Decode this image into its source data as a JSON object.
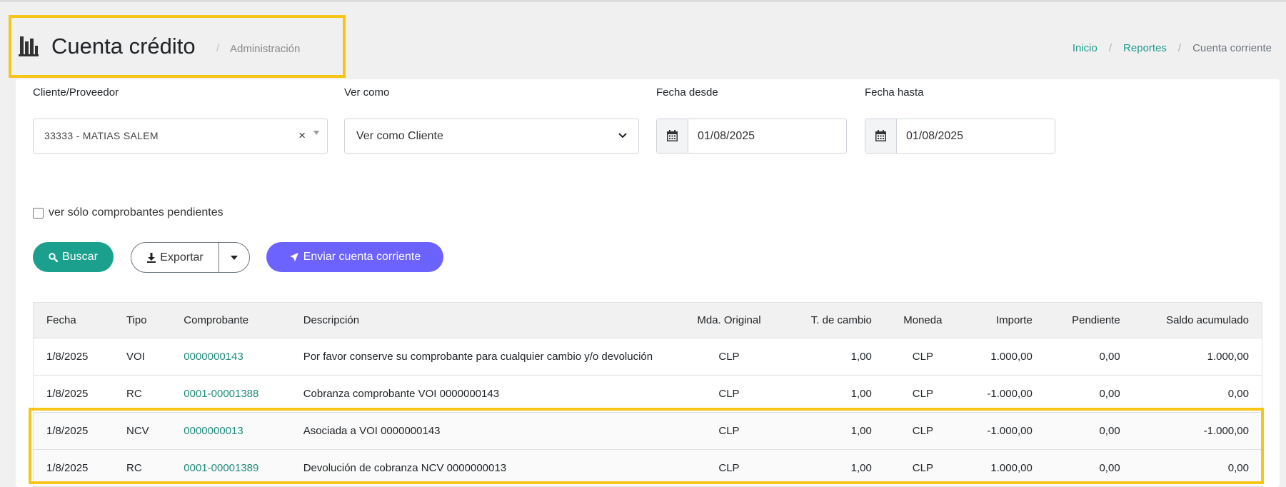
{
  "header": {
    "title": "Cuenta crédito",
    "separator": "/",
    "subtitle": "Administración",
    "breadcrumb": {
      "items": [
        "Inicio",
        "Reportes"
      ],
      "current": "Cuenta corriente"
    }
  },
  "filters": {
    "client_label": "Cliente/Proveedor",
    "client_value": "33333 - MATIAS SALEM",
    "client_clear": "×",
    "vercomo_label": "Ver como",
    "vercomo_value": "Ver como Cliente",
    "fecha_desde_label": "Fecha desde",
    "fecha_desde_value": "01/08/2025",
    "fecha_hasta_label": "Fecha hasta",
    "fecha_hasta_value": "01/08/2025",
    "pendientes_label": "ver sólo comprobantes pendientes",
    "pendientes_checked": false
  },
  "actions": {
    "buscar": "Buscar",
    "exportar": "Exportar",
    "enviar": "Enviar cuenta corriente"
  },
  "icons": {
    "title": "bar-chart-icon",
    "search": "search-icon",
    "download": "download-icon",
    "caret": "caret-down-icon",
    "send": "paper-plane-icon",
    "calendar": "calendar-icon"
  },
  "colors": {
    "accent_teal": "#1aa08d",
    "accent_purple": "#6c63ff",
    "highlight": "#f5c518",
    "link": "#1f8c7c"
  },
  "table": {
    "columns": [
      "Fecha",
      "Tipo",
      "Comprobante",
      "Descripción",
      "Mda. Original",
      "T. de cambio",
      "Moneda",
      "Importe",
      "Pendiente",
      "Saldo acumulado"
    ],
    "rows": [
      [
        "1/8/2025",
        "VOI",
        "0000000143",
        "Por favor conserve su comprobante para cualquier cambio y/o devolución",
        "CLP",
        "1,00",
        "CLP",
        "1.000,00",
        "0,00",
        "1.000,00"
      ],
      [
        "1/8/2025",
        "RC",
        "0001-00001388",
        "Cobranza comprobante VOI 0000000143",
        "CLP",
        "1,00",
        "CLP",
        "-1.000,00",
        "0,00",
        "0,00"
      ],
      [
        "1/8/2025",
        "NCV",
        "0000000013",
        "Asociada a VOI 0000000143",
        "CLP",
        "1,00",
        "CLP",
        "-1.000,00",
        "0,00",
        "-1.000,00"
      ],
      [
        "1/8/2025",
        "RC",
        "0001-00001389",
        "Devolución de cobranza NCV 0000000013",
        "CLP",
        "1,00",
        "CLP",
        "1.000,00",
        "0,00",
        "0,00"
      ]
    ]
  }
}
